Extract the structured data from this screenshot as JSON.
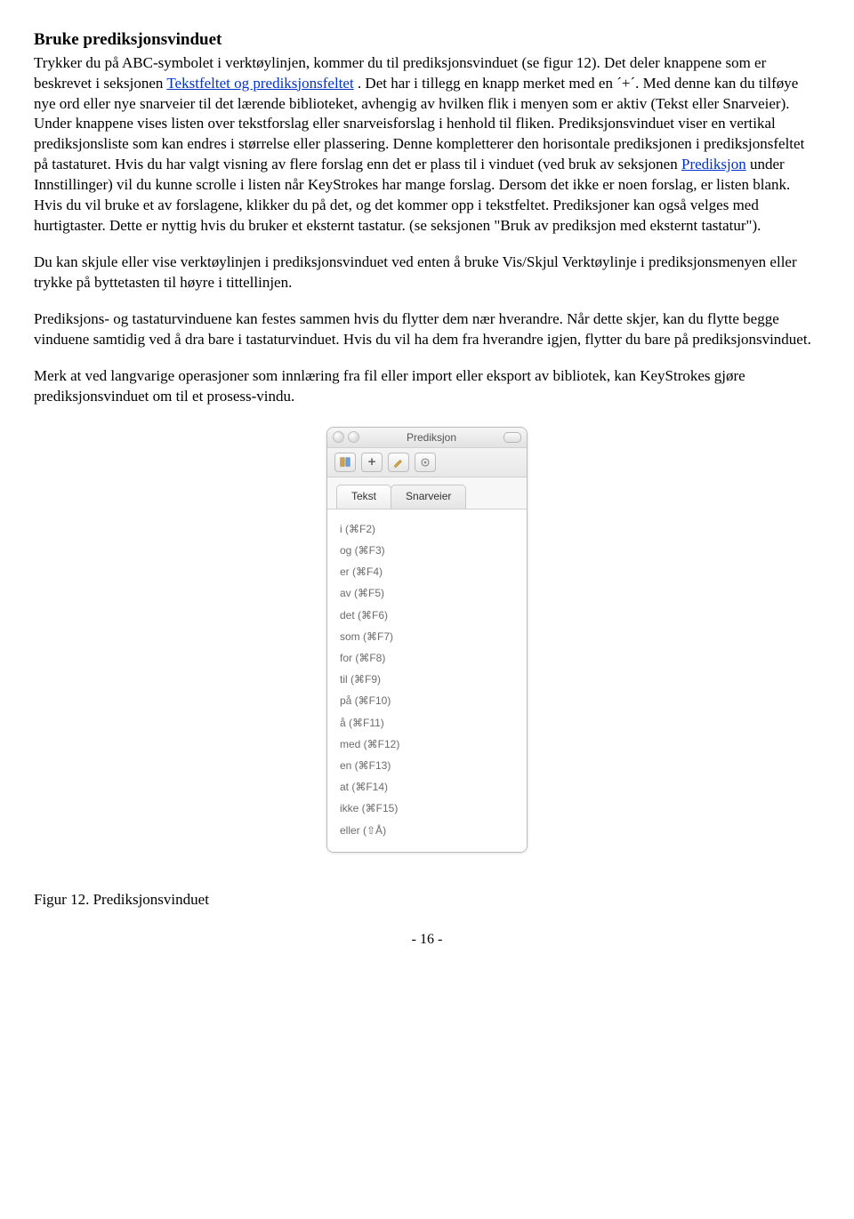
{
  "heading": "Bruke prediksjonsvinduet",
  "para1a": "Trykker du på ABC-symbolet i verktøylinjen, kommer du til prediksjonsvinduet (se figur 12). Det deler knappene som er beskrevet i seksjonen ",
  "link1": " Tekstfeltet og prediksjonsfeltet",
  "para1b": ". Det har i tillegg en knapp merket med en ´+´. Med denne kan du tilføye nye ord eller nye snarveier til det lærende biblioteket, avhengig av hvilken flik i menyen som er aktiv (Tekst eller Snarveier). Under knappene vises listen over tekstforslag eller snarveisforslag i henhold til fliken. Prediksjonsvinduet viser en vertikal prediksjonsliste som kan endres i størrelse eller plassering. Denne kompletterer den horisontale prediksjonen i prediksjonsfeltet på tastaturet. Hvis du har valgt visning av flere forslag enn det er plass til i vinduet (ved bruk av seksjonen ",
  "link2": "Prediksjon",
  "para1c": " under Innstillinger) vil du kunne scrolle i listen når KeyStrokes har mange forslag. Dersom det ikke er noen forslag, er listen blank. Hvis du vil bruke et av forslagene, klikker du på det, og det kommer opp i tekstfeltet. Prediksjoner kan også velges med hurtigtaster. Dette er nyttig hvis du bruker et eksternt tastatur. (se seksjonen \"Bruk av prediksjon med eksternt tastatur\").",
  "para2": "Du kan skjule eller vise verktøylinjen i prediksjonsvinduet ved enten å bruke Vis/Skjul Verktøylinje i prediksjonsmenyen eller trykke på byttetasten til høyre i tittellinjen.",
  "para3": "Prediksjons- og tastaturvinduene kan festes sammen hvis du flytter dem nær hverandre. Når dette skjer, kan du flytte begge vinduene samtidig ved å dra bare i tastaturvinduet. Hvis du vil ha dem fra hverandre igjen, flytter du bare på prediksjonsvinduet.",
  "para4": "Merk at ved langvarige operasjoner som innlæring fra fil eller import eller eksport av bibliotek, kan KeyStrokes gjøre prediksjonsvinduet om til et prosess-vindu.",
  "window": {
    "title": "Prediksjon",
    "tabs": {
      "text": "Tekst",
      "shortcuts": "Snarveier"
    },
    "items": [
      "i (⌘F2)",
      "og (⌘F3)",
      "er (⌘F4)",
      "av (⌘F5)",
      "det (⌘F6)",
      "som (⌘F7)",
      "for (⌘F8)",
      "til (⌘F9)",
      "på (⌘F10)",
      "å (⌘F11)",
      "med (⌘F12)",
      "en (⌘F13)",
      "at (⌘F14)",
      "ikke (⌘F15)",
      "eller (⇧Å)"
    ]
  },
  "figcaption": "Figur 12. Prediksjonsvinduet",
  "pagenum": "- 16 -"
}
